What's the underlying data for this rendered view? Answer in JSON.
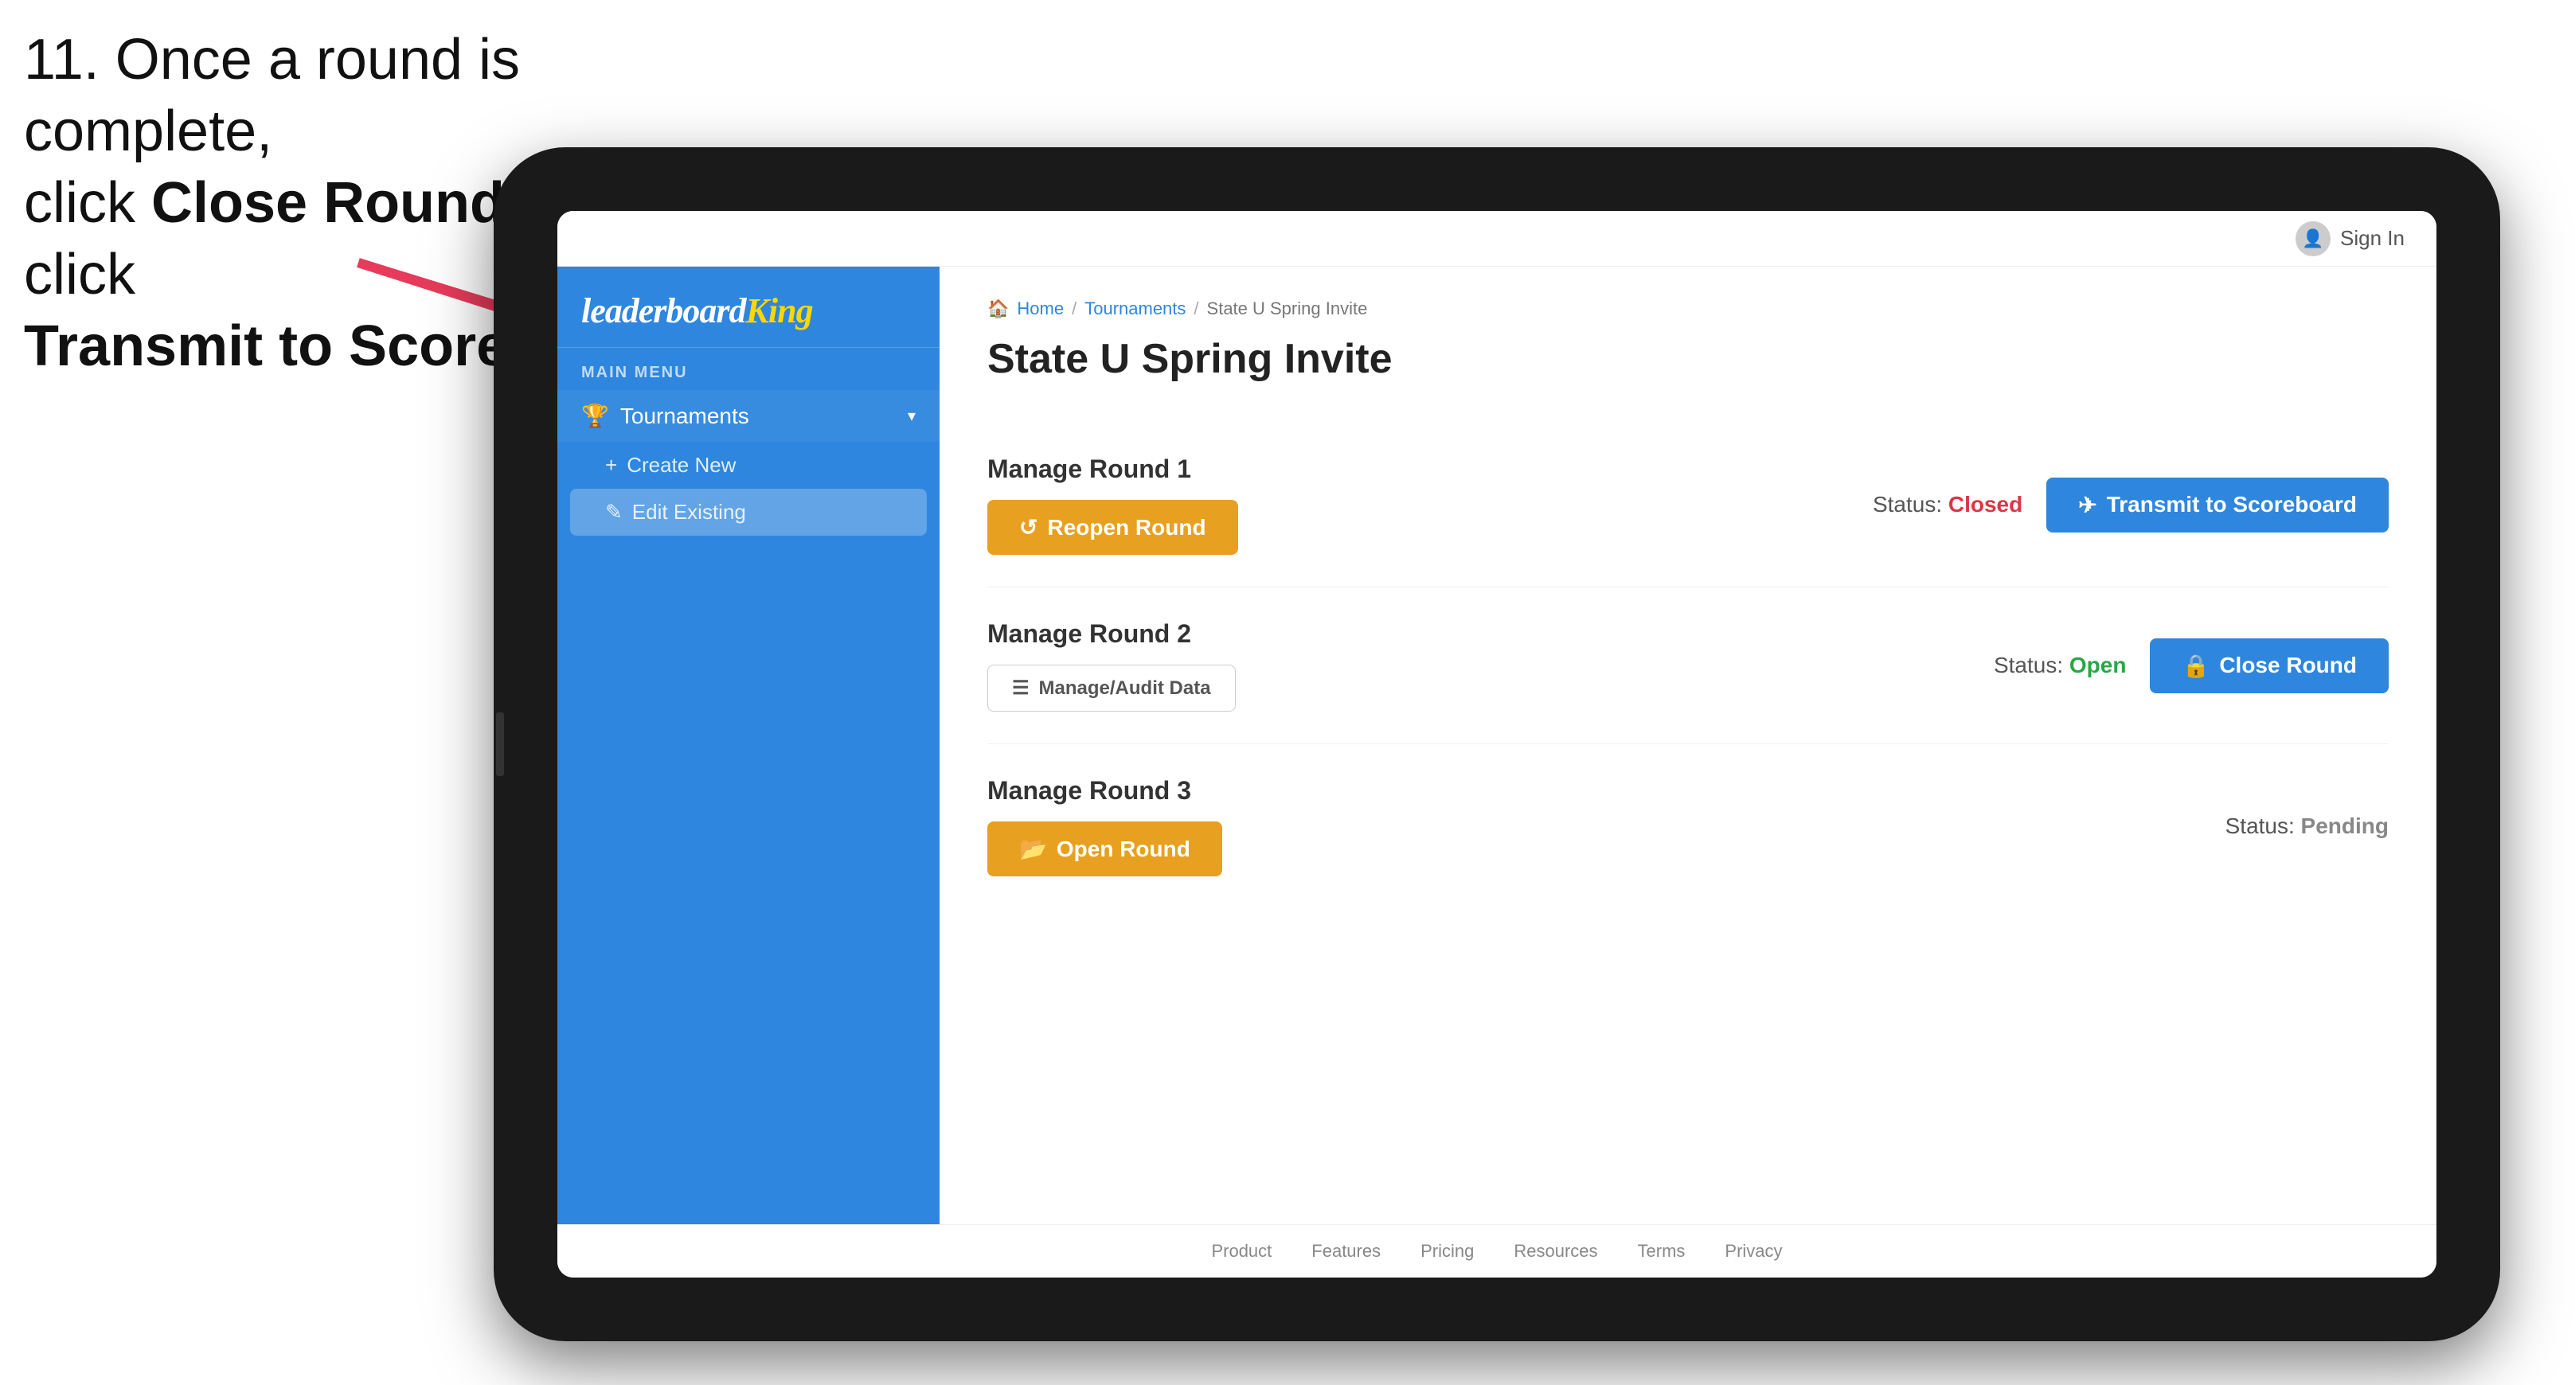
{
  "instruction": {
    "line1": "11. Once a round is complete,",
    "line2": "click ",
    "bold1": "Close Round",
    "line3": " then click",
    "bold2": "Transmit to Scoreboard."
  },
  "topbar": {
    "sign_in": "Sign In"
  },
  "sidebar": {
    "main_menu_label": "MAIN MENU",
    "logo_leaderboard": "leaderboard",
    "logo_king": "King",
    "items": [
      {
        "label": "Tournaments",
        "icon": "🏆"
      }
    ],
    "sub_items": [
      {
        "label": "Create New",
        "icon": "+"
      },
      {
        "label": "Edit Existing",
        "icon": "✎"
      }
    ]
  },
  "breadcrumb": {
    "home": "Home",
    "tournaments": "Tournaments",
    "current": "State U Spring Invite"
  },
  "page": {
    "title": "State U Spring Invite"
  },
  "rounds": [
    {
      "id": 1,
      "title": "Manage Round 1",
      "status_label": "Status:",
      "status_value": "Closed",
      "status_class": "status-closed",
      "buttons": [
        {
          "label": "Reopen Round",
          "style": "amber",
          "icon": "↺"
        },
        {
          "label": "Transmit to Scoreboard",
          "style": "blue",
          "icon": "✈"
        }
      ]
    },
    {
      "id": 2,
      "title": "Manage Round 2",
      "status_label": "Status:",
      "status_value": "Open",
      "status_class": "status-open",
      "buttons": [
        {
          "label": "Manage/Audit Data",
          "style": "outline",
          "icon": "☰"
        },
        {
          "label": "Close Round",
          "style": "blue",
          "icon": "🔒"
        }
      ]
    },
    {
      "id": 3,
      "title": "Manage Round 3",
      "status_label": "Status:",
      "status_value": "Pending",
      "status_class": "status-pending",
      "buttons": [
        {
          "label": "Open Round",
          "style": "amber",
          "icon": "📂"
        }
      ]
    }
  ],
  "footer": {
    "links": [
      "Product",
      "Features",
      "Pricing",
      "Resources",
      "Terms",
      "Privacy"
    ]
  }
}
